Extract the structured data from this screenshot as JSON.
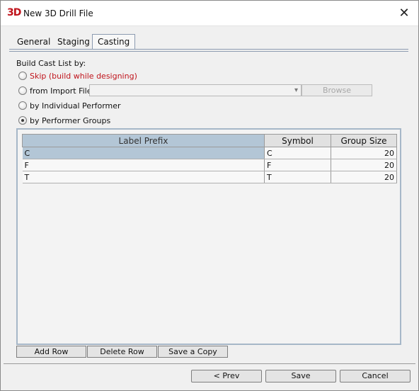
{
  "window": {
    "icon_text": "3D",
    "title": "New 3D Drill File",
    "close_glyph": "✕"
  },
  "tabs": [
    {
      "label": "General",
      "active": false
    },
    {
      "label": "Staging",
      "active": false
    },
    {
      "label": "Casting",
      "active": true
    }
  ],
  "cast_list": {
    "label": "Build Cast List by:",
    "options": [
      {
        "label": "Skip (build while designing)",
        "checked": false
      },
      {
        "label": "from Import File",
        "checked": false
      },
      {
        "label": "by Individual Performer",
        "checked": false
      },
      {
        "label": "by Performer Groups",
        "checked": true
      }
    ],
    "import_file_value": "",
    "browse_label": "Browse"
  },
  "table": {
    "columns": [
      "Label Prefix",
      "Symbol",
      "Group Size"
    ],
    "rows": [
      {
        "label_prefix": "C",
        "symbol": "C",
        "group_size": "20"
      },
      {
        "label_prefix": "F",
        "symbol": "F",
        "group_size": "20"
      },
      {
        "label_prefix": "T",
        "symbol": "T",
        "group_size": "20"
      }
    ]
  },
  "table_buttons": {
    "add_row": "Add Row",
    "delete_row": "Delete Row",
    "save_copy": "Save a Copy"
  },
  "footer": {
    "prev": "< Prev",
    "save": "Save",
    "cancel": "Cancel"
  },
  "colors": {
    "accent_red": "#c0141c",
    "selection_blue": "#b3c6d6",
    "panel_border": "#a6b7c8"
  },
  "icons": {
    "app": "3d-logo-icon",
    "close": "close-icon",
    "dropdown": "chevron-down-icon"
  }
}
